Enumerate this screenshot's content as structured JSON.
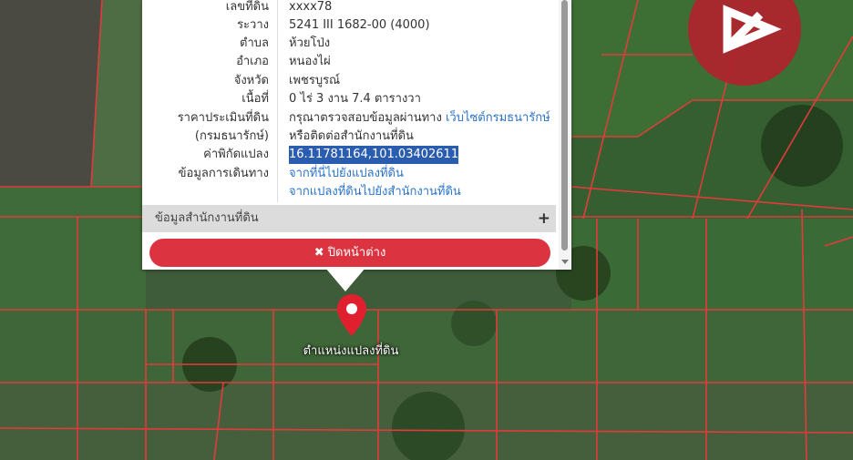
{
  "popup": {
    "rows": [
      {
        "label": "เลขที่ดิน",
        "value": "xxxx78"
      },
      {
        "label": "ระวาง",
        "value": "5241 III 1682-00 (4000)"
      },
      {
        "label": "ตำบล",
        "value": "ห้วยโป่ง"
      },
      {
        "label": "อำเภอ",
        "value": "หนองไผ่"
      },
      {
        "label": "จังหวัด",
        "value": "เพชรบูรณ์"
      },
      {
        "label": "เนื้อที่",
        "value": "0 ไร่ 3 งาน 7.4 ตารางวา"
      },
      {
        "label": "ราคาประเมินที่ดิน",
        "value": "กรุณาตรวจสอบข้อมูลผ่านทาง",
        "link": "เว็บไซต์กรมธนารักษ์"
      },
      {
        "label": "(กรมธนารักษ์)",
        "value": "หรือติดต่อสำนักงานที่ดิน"
      },
      {
        "label": "ค่าพิกัดแปลง",
        "value": "16.11781164,101.03402611"
      },
      {
        "label": "ข้อมูลการเดินทาง",
        "link": "จากที่นี่ไปยังแปลงที่ดิน"
      },
      {
        "label": "",
        "link": "จากแปลงที่ดินไปยังสำนักงานที่ดิน"
      }
    ],
    "office_section": "ข้อมูลสำนักงานที่ดิน",
    "office_toggle": "+",
    "close_icon": "✖",
    "close_label": "ปิดหน้าต่าง"
  },
  "marker_label": "ตำแหน่งแปลงที่ดิน",
  "colors": {
    "accent": "#db3440",
    "link": "#2a73c9",
    "highlight": "#2a5db0",
    "parcel_line": "#e23b3b"
  }
}
